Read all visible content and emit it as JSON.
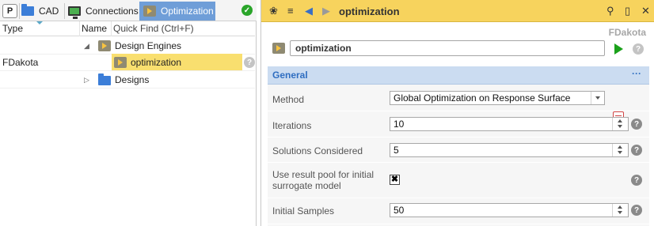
{
  "left": {
    "tabs": {
      "p_label": "P",
      "cad": "CAD",
      "connections": "Connections",
      "optimization": "Optimization"
    },
    "columns": {
      "type": "Type",
      "name": "Name",
      "quick_find": "Quick Find (Ctrl+F)"
    },
    "tree": [
      {
        "type": "",
        "label": "Design Engines",
        "icon": "play-icon",
        "expanded": true
      },
      {
        "type": "FDakota",
        "label": "optimization",
        "icon": "play-icon",
        "selected": true
      },
      {
        "type": "",
        "label": "Designs",
        "icon": "folder-icon",
        "expanded": false
      }
    ],
    "help": "?"
  },
  "right": {
    "toolbar_title": "optimization",
    "type_label": "FDakota",
    "object_name": "optimization",
    "section": {
      "title": "General",
      "more": "···"
    },
    "properties": {
      "method": {
        "label": "Method",
        "value": "Global Optimization on Response Surface"
      },
      "iterations": {
        "label": "Iterations",
        "value": "10"
      },
      "solutions": {
        "label": "Solutions Considered",
        "value": "5"
      },
      "result_pool": {
        "label": "Use result pool for initial surrogate model",
        "checked": true
      },
      "initial_samples": {
        "label": "Initial Samples",
        "value": "50"
      }
    },
    "help": "?"
  },
  "colors": {
    "title_bar": "#f7d35d",
    "selection": "#f9df6f",
    "active_tab": "#6f9ed8",
    "section_header": "#cbdcf1",
    "section_text": "#2f6ec1",
    "run_green": "#1ba11b"
  }
}
